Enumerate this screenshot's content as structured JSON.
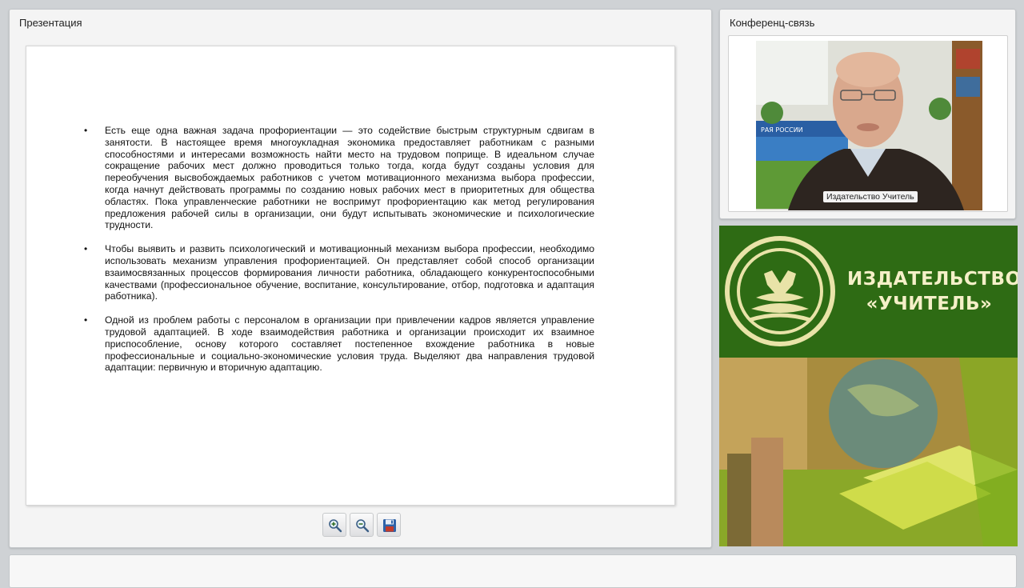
{
  "presentation": {
    "title": "Презентация",
    "bullets": [
      "Есть еще одна важная задача профориентации — это содействие быстрым структурным сдвигам в занятости. В настоящее время многоукладная экономика предоставляет работникам с разными способностями и интересами возможность найти место на трудовом поприще. В идеальном случае сокращение рабочих мест должно проводиться только тогда, когда будут созданы условия для переобучения высвобождаемых работников с учетом мотивационного механизма выбора профессии, когда начнут действовать программы по созданию новых рабочих мест в приоритетных для общества областях. Пока управленческие работники не воспримут профориентацию как метод регулирования предложения рабочей силы в организации, они будут испытывать экономические и психологические трудности.",
      "Чтобы выявить и развить психологический и мотивационный механизм выбора профессии, необходимо использовать механизм управления профориентацией. Он представляет собой способ организации взаимосвязанных процессов формирования личности работника, обладающего конкурентоспособными качествами (профессиональное обучение, воспитание, консультирование, отбор, подготовка и адаптация работника).",
      "Одной из проблем работы с персоналом в организации при привлечении кадров является управление трудовой адаптацией. В ходе взаимодействия работника и организации происходит их взаимное приспособление, основу которого составляет постепенное вхождение работника в новые профессиональные и социально-экономические условия труда. Выделяют два направления трудовой адаптации: первичную и вторичную адаптацию."
    ],
    "bullet_symbol": "•",
    "toolbar": {
      "zoom_in_icon": "zoom-in-icon",
      "zoom_out_icon": "zoom-out-icon",
      "save_icon": "floppy-disk-icon"
    }
  },
  "conference": {
    "title": "Конференц-связь",
    "participant_label": "Издательство Учитель",
    "wall_text": "РАЯ РОССИИ"
  },
  "banner": {
    "line1": "ИЗДАТЕЛЬСТВО",
    "line2": "«УЧИТЕЛЬ»",
    "colors": {
      "green": "#2e6b14",
      "text": "#f5f0c8"
    }
  }
}
